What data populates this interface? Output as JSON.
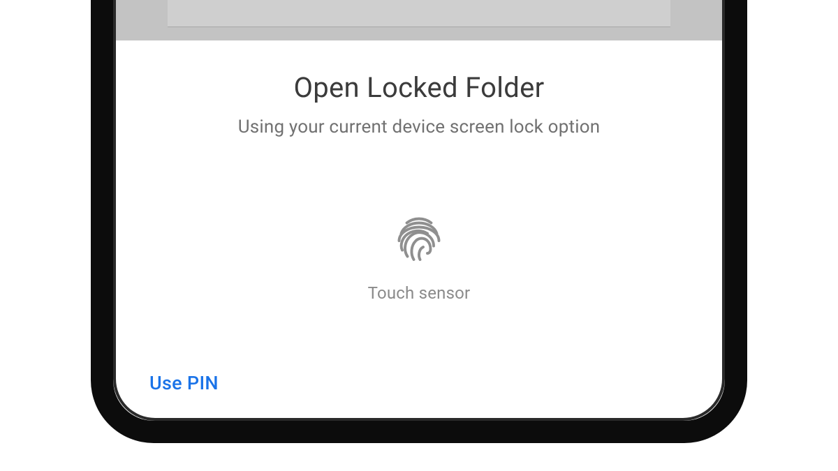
{
  "dialog": {
    "title": "Open Locked Folder",
    "subtitle": "Using your current device screen lock option",
    "sensor_label": "Touch sensor",
    "use_pin_label": "Use PIN"
  },
  "colors": {
    "link": "#1a73e8",
    "text_primary": "#3b3b3b",
    "text_secondary": "#717171",
    "text_muted": "#8a8a8a"
  }
}
